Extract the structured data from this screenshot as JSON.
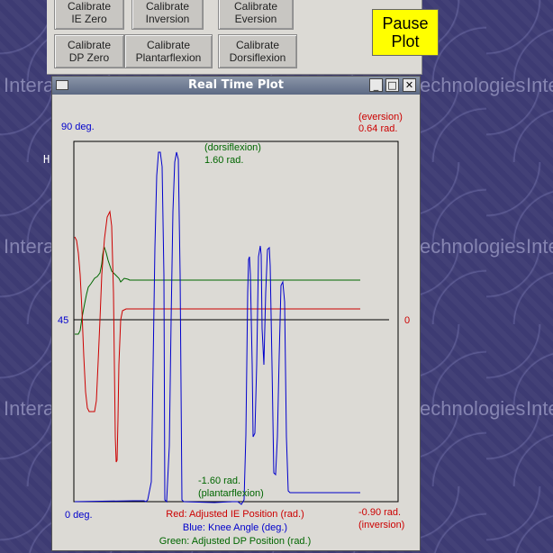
{
  "watermark": {
    "left_text": "Intera",
    "right_text": "echnologies",
    "edge_text": "Inte"
  },
  "desktop": {
    "cursor_glyph": "H"
  },
  "panel": {
    "buttons": [
      {
        "line1": "Calibrate",
        "line2": "IE Zero"
      },
      {
        "line1": "Calibrate",
        "line2": "Inversion"
      },
      {
        "line1": "Calibrate",
        "line2": "Eversion"
      },
      {
        "line1": "Calibrate",
        "line2": "DP Zero"
      },
      {
        "line1": "Calibrate",
        "line2": "Plantarflexion"
      },
      {
        "line1": "Calibrate",
        "line2": "Dorsiflexion"
      }
    ],
    "pause": {
      "line1": "Pause",
      "line2": "Plot",
      "color": "#ffff00"
    }
  },
  "window": {
    "title": "Real Time Plot",
    "minimize_glyph": "_",
    "maximize_glyph": "□",
    "close_glyph": "✕"
  },
  "plot": {
    "colors": {
      "ie": "#cc0000",
      "knee": "#0000cc",
      "dp": "#006600",
      "zero": "#000000"
    },
    "labels": {
      "knee_top": "90 deg.",
      "knee_mid": "45",
      "knee_bottom": "0 deg.",
      "ie_top_1": "(eversion)",
      "ie_top_2": "0.64 rad.",
      "ie_mid": "0",
      "ie_bottom_1": "-0.90 rad.",
      "ie_bottom_2": "(inversion)",
      "dp_top_1": "(dorsiflexion)",
      "dp_top_2": "1.60 rad.",
      "dp_bottom_1": "-1.60 rad.",
      "dp_bottom_2": "(plantarflexion)"
    },
    "legend": {
      "red": "Red: Adjusted IE Position (rad.)",
      "blue": "Blue: Knee Angle (deg.)",
      "green": "Green: Adjusted DP Position (rad.)"
    }
  }
}
